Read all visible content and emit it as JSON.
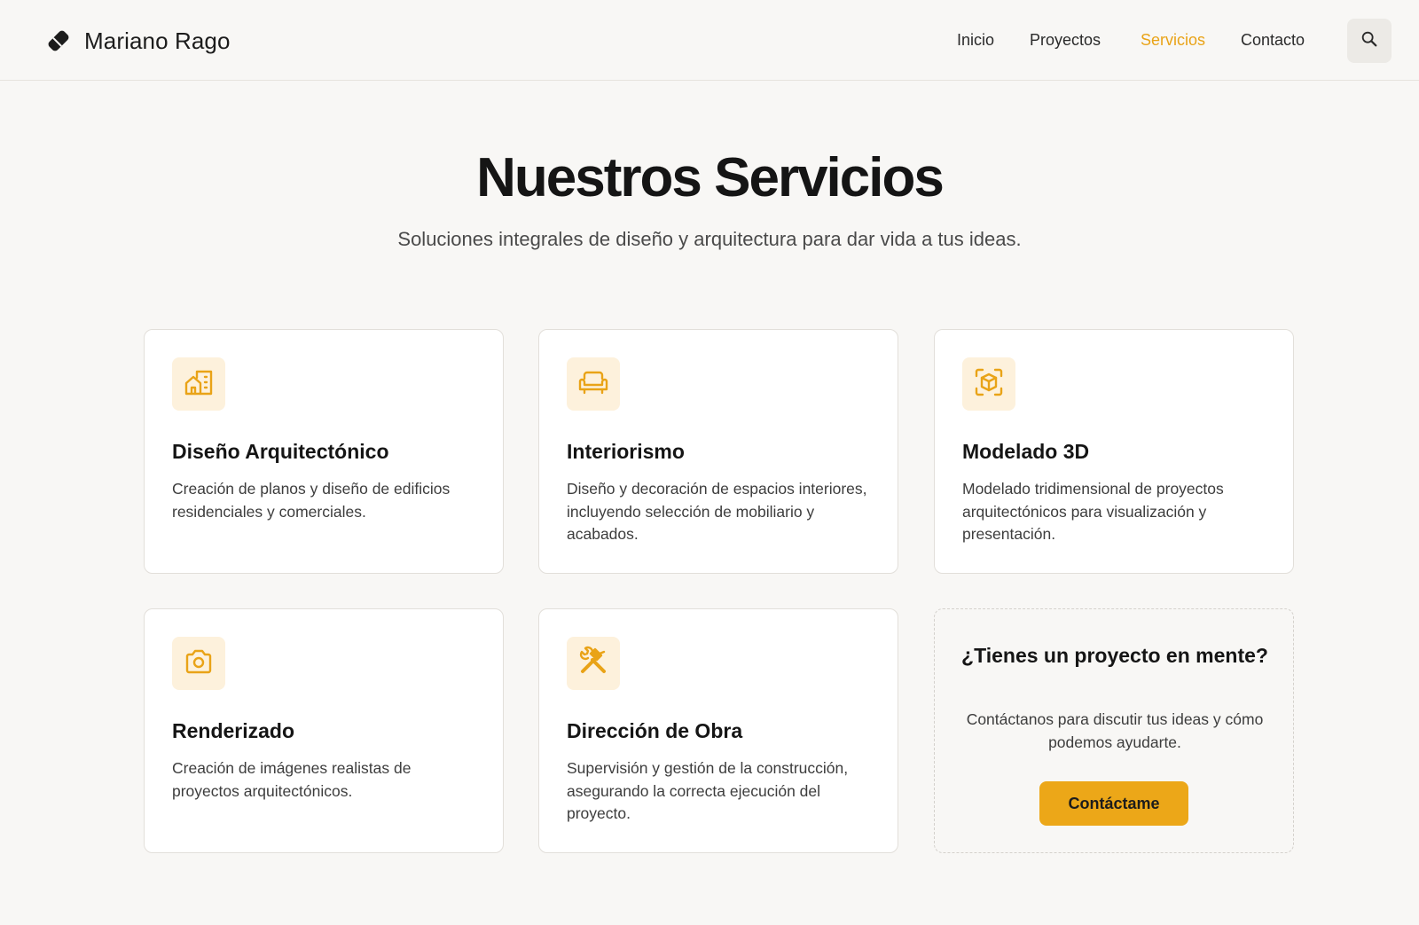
{
  "header": {
    "brand_name": "Mariano Rago",
    "logo_icon": "pencil-eraser-icon",
    "nav": [
      {
        "label": "Inicio",
        "active": false
      },
      {
        "label": "Proyectos",
        "active": false
      },
      {
        "label": "Servicios",
        "active": true
      },
      {
        "label": "Contacto",
        "active": false
      }
    ],
    "search_icon": "search-icon"
  },
  "hero": {
    "title": "Nuestros Servicios",
    "subtitle": "Soluciones integrales de diseño y arquitectura para dar vida a tus ideas."
  },
  "services": [
    {
      "icon": "buildings-icon",
      "title": "Diseño Arquitectónico",
      "description": "Creación de planos y diseño de edificios residenciales y comerciales."
    },
    {
      "icon": "sofa-icon",
      "title": "Interiorismo",
      "description": "Diseño y decoración de espacios interiores, incluyendo selección de mobiliario y acabados."
    },
    {
      "icon": "cube-scan-icon",
      "title": "Modelado 3D",
      "description": "Modelado tridimensional de proyectos arquitectónicos para visualización y presentación."
    },
    {
      "icon": "camera-icon",
      "title": "Renderizado",
      "description": "Creación de imágenes realistas de proyectos arquitectónicos."
    },
    {
      "icon": "hammer-wrench-icon",
      "title": "Dirección de Obra",
      "description": "Supervisión y gestión de la construcción, asegurando la correcta ejecución del proyecto."
    }
  ],
  "cta": {
    "title": "¿Tienes un proyecto en mente?",
    "description": "Contáctanos para discutir tus ideas y cómo podemos ayudarte.",
    "button_label": "Contáctame"
  },
  "colors": {
    "accent": "#e9a317",
    "accent_button": "#eca718",
    "icon_bg": "#fdf1dc",
    "page_bg": "#f8f7f5",
    "text": "#1c1c1c"
  }
}
